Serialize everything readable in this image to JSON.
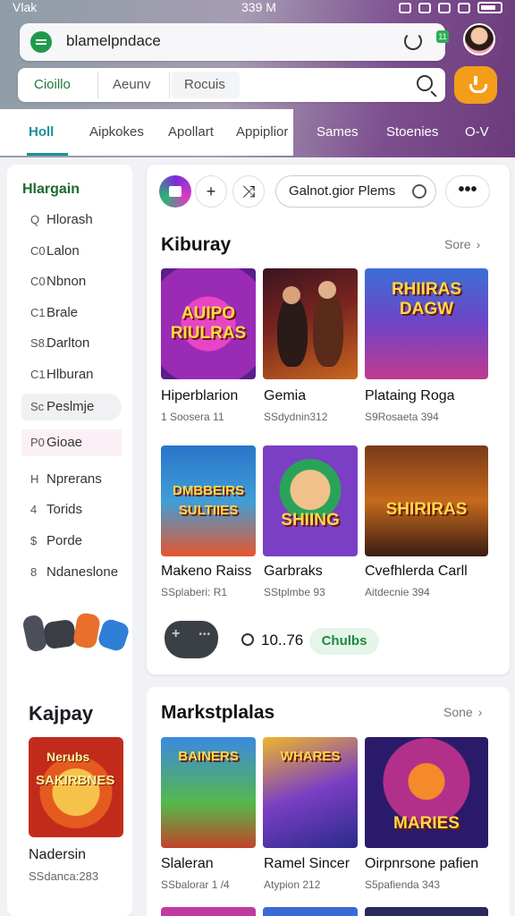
{
  "status_bar": {
    "carrier": "Vlak",
    "time": "339 M"
  },
  "address_bar": {
    "url": "blamelpndace",
    "badge": "11"
  },
  "search_row": {
    "seg1": "Cioillo",
    "seg2": "Aeunv",
    "seg3": "Rocuis"
  },
  "tabs": [
    {
      "label": "Holl",
      "active": true
    },
    {
      "label": "Aipkokes"
    },
    {
      "label": "Apollart"
    },
    {
      "label": "Appiplior"
    },
    {
      "label": "Sames"
    },
    {
      "label": "Stoenies"
    },
    {
      "label": "O-V"
    }
  ],
  "sidebar": {
    "title": "Hlargain",
    "items": [
      {
        "icon": "search-icon",
        "prefix": "Q",
        "label": "Hlorash"
      },
      {
        "icon": "collection-icon",
        "prefix": "C0",
        "label": "Lalon"
      },
      {
        "icon": "collection-icon",
        "prefix": "C0",
        "label": "Nbnon"
      },
      {
        "icon": "category-icon",
        "prefix": "C1",
        "label": "Brale"
      },
      {
        "icon": "category-icon",
        "prefix": "S8.",
        "label": "Darlton"
      },
      {
        "icon": "category-icon",
        "prefix": "C1",
        "label": "Hlburan"
      },
      {
        "icon": "category-icon",
        "prefix": "Sc",
        "label": "Peslmje"
      },
      {
        "icon": "category-icon",
        "prefix": "P0",
        "label": "Gioae"
      },
      {
        "icon": "category-icon",
        "prefix": "H",
        "label": "Nprerans"
      },
      {
        "icon": "category-icon",
        "prefix": "4",
        "label": "Torids"
      },
      {
        "icon": "dollar-icon",
        "prefix": "$",
        "label": "Porde"
      },
      {
        "icon": "category-icon",
        "prefix": "8",
        "label": "Ndaneslone"
      }
    ],
    "section_title": "Kajpay",
    "card": {
      "art": "SAKIRBNES",
      "art_top": "Nerubs",
      "title": "Nadersin",
      "sub": "SSdanca:283"
    }
  },
  "toolbar": {
    "plus": "+",
    "shuffle": "⤨",
    "search_text": "Galnot.gior Plems",
    "more": "•••"
  },
  "library": {
    "title": "Kiburay",
    "more": "Sore",
    "games": [
      {
        "art": "AUIPO RIULRAS",
        "title": "Hiperblarion",
        "sub": "1 Soosera 11"
      },
      {
        "art": "",
        "title": "Gemia",
        "sub": "SSdydnin312"
      },
      {
        "art": "RHIIRAS DAGW",
        "title": "Plataing Roga",
        "sub": "S9Rosaeta 394"
      },
      {
        "art": "DMBBEIRS SULTIIES",
        "title": "Makeno Raiss",
        "sub": "SSplaberi: R1"
      },
      {
        "art": "SHIING",
        "title": "Garbraks",
        "sub": "SStplmbe 93"
      },
      {
        "art": "SHIRIRAS",
        "title": "Cvefhlerda Carll",
        "sub": "Aitdecnie 394"
      }
    ],
    "players": "10..76",
    "pill": "Chulbs"
  },
  "marketplace": {
    "title": "Markstplalas",
    "more": "Sone",
    "games": [
      {
        "art": "BAINERS",
        "title": "Slaleran",
        "sub": "SSbalorar 1 /4"
      },
      {
        "art": "WHARES",
        "title": "Ramel Sincer",
        "sub": "Atypion 212"
      },
      {
        "art": "MARIES",
        "title": "Oirpnrsone pafien",
        "sub": "S5pafienda 343"
      }
    ]
  },
  "colors": {
    "accent": "#1e8f9a",
    "green": "#1f9a4a",
    "orange": "#f49d1a"
  }
}
